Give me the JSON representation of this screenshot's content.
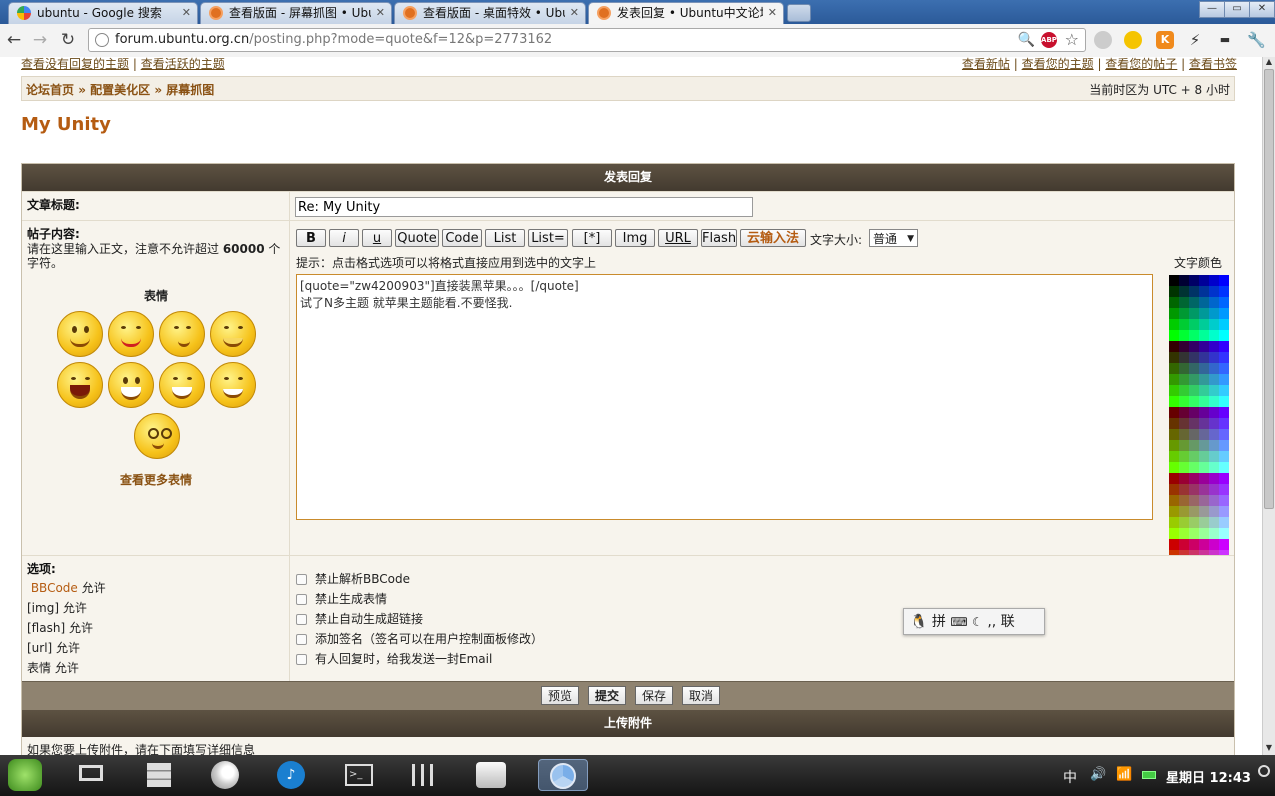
{
  "browser": {
    "tabs": [
      {
        "title": "ubuntu - Google 搜索",
        "active": false
      },
      {
        "title": "查看版面 - 屏幕抓图 • Ubuntu",
        "active": false
      },
      {
        "title": "查看版面 - 桌面特效 • Ubuntu",
        "active": false
      },
      {
        "title": "发表回复 • Ubuntu中文论坛",
        "active": true
      }
    ],
    "url_host": "forum.ubuntu.org.cn",
    "url_path": "/posting.php?mode=quote&f=12&p=2773162",
    "window_buttons": {
      "minimize": "—",
      "maximize": "▭",
      "close": "✕"
    }
  },
  "top_links": {
    "left": [
      "查看没有回复的主题",
      "查看活跃的主题"
    ],
    "right": [
      "查看新帖",
      "查看您的主题",
      "查看您的帖子",
      "查看书签"
    ]
  },
  "breadcrumb": {
    "items": [
      "论坛首页",
      "配置美化区",
      "屏幕抓图"
    ],
    "sep": " » "
  },
  "timezone": "当前时区为 UTC + 8 小时",
  "page_title": "My Unity",
  "form": {
    "header": "发表回复",
    "subject_label": "文章标题:",
    "subject_value": "Re: My Unity",
    "body_label": "帖子内容:",
    "body_desc_1": "请在这里输入正文，注意不允许超过 ",
    "body_desc_limit": "60000",
    "body_desc_2": " 个字符。",
    "smilies_title": "表情",
    "more_smilies": "查看更多表情",
    "buttons": [
      "B",
      "i",
      "u",
      "Quote",
      "Code",
      "List",
      "List=",
      "[*]",
      "Img",
      "URL",
      "Flash"
    ],
    "cloud_input": "云输入法",
    "font_size_label": "文字大小:",
    "font_size_value": "普通",
    "hint": "提示：点击格式选项可以将格式直接应用到选中的文字上",
    "color_label": "文字颜色",
    "editor_text": "[quote=\"zw4200903\"]直接装黑苹果。。。[/quote]\n试了N多主题 就苹果主题能看.不要怪我.",
    "options_label": "选项:",
    "options_left": [
      {
        "link": "BBCode",
        "text": " 允许"
      },
      {
        "link": "",
        "text": "[img] 允许"
      },
      {
        "link": "",
        "text": "[flash] 允许"
      },
      {
        "link": "",
        "text": "[url] 允许"
      },
      {
        "link": "",
        "text": "表情 允许"
      }
    ],
    "checkboxes": [
      "禁止解析BBCode",
      "禁止生成表情",
      "禁止自动生成超链接",
      "添加签名（签名可以在用户控制面板修改）",
      "有人回复时，给我发送一封Email"
    ],
    "submit_buttons": [
      "预览",
      "提交",
      "保存",
      "取消"
    ],
    "attach_header": "上传附件",
    "attach_hint": "如果您要上传附件，请在下面填写详细信息"
  },
  "ime": {
    "text": "拼",
    "mode": "联"
  },
  "taskbar": {
    "apps": [
      "linux-deepin-logo",
      "desktop",
      "file-manager",
      "firefox",
      "music-player",
      "terminal",
      "mixer",
      "disk",
      "chrome"
    ],
    "tray_ime": "中",
    "clock": "星期日 12:43"
  },
  "palette_rows": [
    [
      "#000000",
      "#000033",
      "#000066",
      "#000099",
      "#0000cc",
      "#0000ff"
    ],
    [
      "#003300",
      "#003333",
      "#003366",
      "#003399",
      "#0033cc",
      "#0033ff"
    ],
    [
      "#006600",
      "#006633",
      "#006666",
      "#006699",
      "#0066cc",
      "#0066ff"
    ],
    [
      "#009900",
      "#009933",
      "#009966",
      "#009999",
      "#0099cc",
      "#0099ff"
    ],
    [
      "#00cc00",
      "#00cc33",
      "#00cc66",
      "#00cc99",
      "#00cccc",
      "#00ccff"
    ],
    [
      "#00ff00",
      "#00ff33",
      "#00ff66",
      "#00ff99",
      "#00ffcc",
      "#00ffff"
    ],
    [
      "#330000",
      "#330033",
      "#330066",
      "#330099",
      "#3300cc",
      "#3300ff"
    ],
    [
      "#333300",
      "#333333",
      "#333366",
      "#333399",
      "#3333cc",
      "#3333ff"
    ],
    [
      "#336600",
      "#336633",
      "#336666",
      "#336699",
      "#3366cc",
      "#3366ff"
    ],
    [
      "#339900",
      "#339933",
      "#339966",
      "#339999",
      "#3399cc",
      "#3399ff"
    ],
    [
      "#33cc00",
      "#33cc33",
      "#33cc66",
      "#33cc99",
      "#33cccc",
      "#33ccff"
    ],
    [
      "#33ff00",
      "#33ff33",
      "#33ff66",
      "#33ff99",
      "#33ffcc",
      "#33ffff"
    ],
    [
      "#660000",
      "#660033",
      "#660066",
      "#660099",
      "#6600cc",
      "#6600ff"
    ],
    [
      "#663300",
      "#663333",
      "#663366",
      "#663399",
      "#6633cc",
      "#6633ff"
    ],
    [
      "#666600",
      "#666633",
      "#666666",
      "#666699",
      "#6666cc",
      "#6666ff"
    ],
    [
      "#669900",
      "#669933",
      "#669966",
      "#669999",
      "#6699cc",
      "#6699ff"
    ],
    [
      "#66cc00",
      "#66cc33",
      "#66cc66",
      "#66cc99",
      "#66cccc",
      "#66ccff"
    ],
    [
      "#66ff00",
      "#66ff33",
      "#66ff66",
      "#66ff99",
      "#66ffcc",
      "#66ffff"
    ],
    [
      "#990000",
      "#990033",
      "#990066",
      "#990099",
      "#9900cc",
      "#9900ff"
    ],
    [
      "#993300",
      "#993333",
      "#993366",
      "#993399",
      "#9933cc",
      "#9933ff"
    ],
    [
      "#996600",
      "#996633",
      "#996666",
      "#996699",
      "#9966cc",
      "#9966ff"
    ],
    [
      "#999900",
      "#999933",
      "#999966",
      "#999999",
      "#9999cc",
      "#9999ff"
    ],
    [
      "#99cc00",
      "#99cc33",
      "#99cc66",
      "#99cc99",
      "#99cccc",
      "#99ccff"
    ],
    [
      "#99ff00",
      "#99ff33",
      "#99ff66",
      "#99ff99",
      "#99ffcc",
      "#99ffff"
    ],
    [
      "#cc0000",
      "#cc0033",
      "#cc0066",
      "#cc0099",
      "#cc00cc",
      "#cc00ff"
    ],
    [
      "#cc3300",
      "#cc3333",
      "#cc3366",
      "#cc3399",
      "#cc33cc",
      "#cc33ff"
    ],
    [
      "#cc6600",
      "#cc6633",
      "#cc6666",
      "#cc6699",
      "#cc66cc",
      "#cc66ff"
    ],
    [
      "#cc9900",
      "#cc9933",
      "#cc9966",
      "#cc9999",
      "#cc99cc",
      "#cc99ff"
    ],
    [
      "#cccc00",
      "#cccc33",
      "#cccc66",
      "#cccc99",
      "#cccccc",
      "#ccccff"
    ],
    [
      "#ccff00",
      "#ccff33",
      "#ccff66",
      "#ccff99",
      "#ccffcc",
      "#ccffff"
    ],
    [
      "#ff0000",
      "#ff0033",
      "#ff0066",
      "#ff0099",
      "#ff00cc",
      "#ff00ff"
    ],
    [
      "#ff3300",
      "#ff3333",
      "#ff3366",
      "#ff3399",
      "#ff33cc",
      "#ff33ff"
    ],
    [
      "#ff6600",
      "#ff6633",
      "#ff6666",
      "#ff6699",
      "#ff66cc",
      "#ff66ff"
    ],
    [
      "#ff9900",
      "#ff9933",
      "#ff9966",
      "#ff9999",
      "#ff99cc",
      "#ff99ff"
    ],
    [
      "#ffcc00",
      "#ffcc33",
      "#ffcc66",
      "#ffcc99",
      "#ffcccc",
      "#ffccff"
    ],
    [
      "#ffff00",
      "#ffff33",
      "#ffff66",
      "#ffff99",
      "#ffffcc",
      "#ffffff"
    ]
  ],
  "colors": {
    "accent": "#b55c12",
    "header_dark": "#433a2f",
    "submit_bar": "#8f8370"
  }
}
